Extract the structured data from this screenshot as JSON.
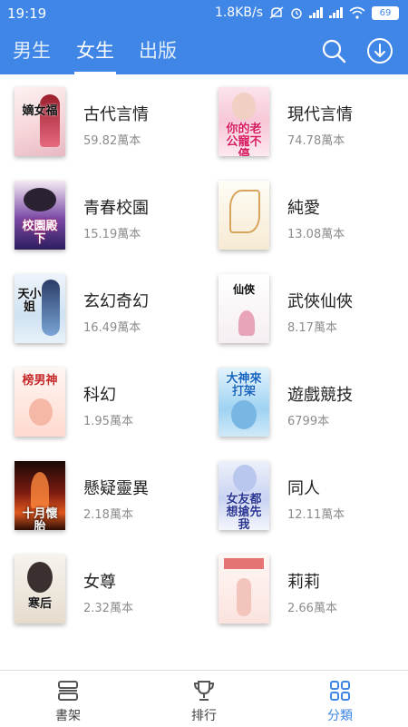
{
  "status_bar": {
    "time": "19:19",
    "network_speed": "1.8KB/s",
    "battery": "69"
  },
  "top_nav": {
    "tabs": [
      {
        "label": "男生",
        "active": false
      },
      {
        "label": "女生",
        "active": true
      },
      {
        "label": "出版",
        "active": false
      }
    ],
    "search_icon": "search-icon",
    "download_icon": "download-icon"
  },
  "categories": [
    {
      "name": "古代言情",
      "count": "59.82萬本",
      "cover_text": "嫡女福"
    },
    {
      "name": "現代言情",
      "count": "74.78萬本",
      "cover_text": "你的老公寵不停"
    },
    {
      "name": "青春校園",
      "count": "15.19萬本",
      "cover_text": "校園殿下"
    },
    {
      "name": "純愛",
      "count": "13.08萬本",
      "cover_text": ""
    },
    {
      "name": "玄幻奇幻",
      "count": "16.49萬本",
      "cover_text": "天小姐"
    },
    {
      "name": "武俠仙俠",
      "count": "8.17萬本",
      "cover_text": "仙俠"
    },
    {
      "name": "科幻",
      "count": "1.95萬本",
      "cover_text": "榜男神"
    },
    {
      "name": "遊戲競技",
      "count": "6799本",
      "cover_text": "大神來打架"
    },
    {
      "name": "懸疑靈異",
      "count": "2.18萬本",
      "cover_text": "十月懷胎"
    },
    {
      "name": "同人",
      "count": "12.11萬本",
      "cover_text": "女友都想搶先我"
    },
    {
      "name": "女尊",
      "count": "2.32萬本",
      "cover_text": "寒后"
    },
    {
      "name": "莉莉",
      "count": "2.66萬本",
      "cover_text": ""
    }
  ],
  "bottom_nav": [
    {
      "label": "書架",
      "icon": "bookshelf-icon",
      "active": false
    },
    {
      "label": "排行",
      "icon": "trophy-icon",
      "active": false
    },
    {
      "label": "分類",
      "icon": "category-grid-icon",
      "active": true
    }
  ],
  "colors": {
    "accent": "#3f86e6",
    "text_primary": "#222222",
    "text_secondary": "#8c8c8c"
  }
}
